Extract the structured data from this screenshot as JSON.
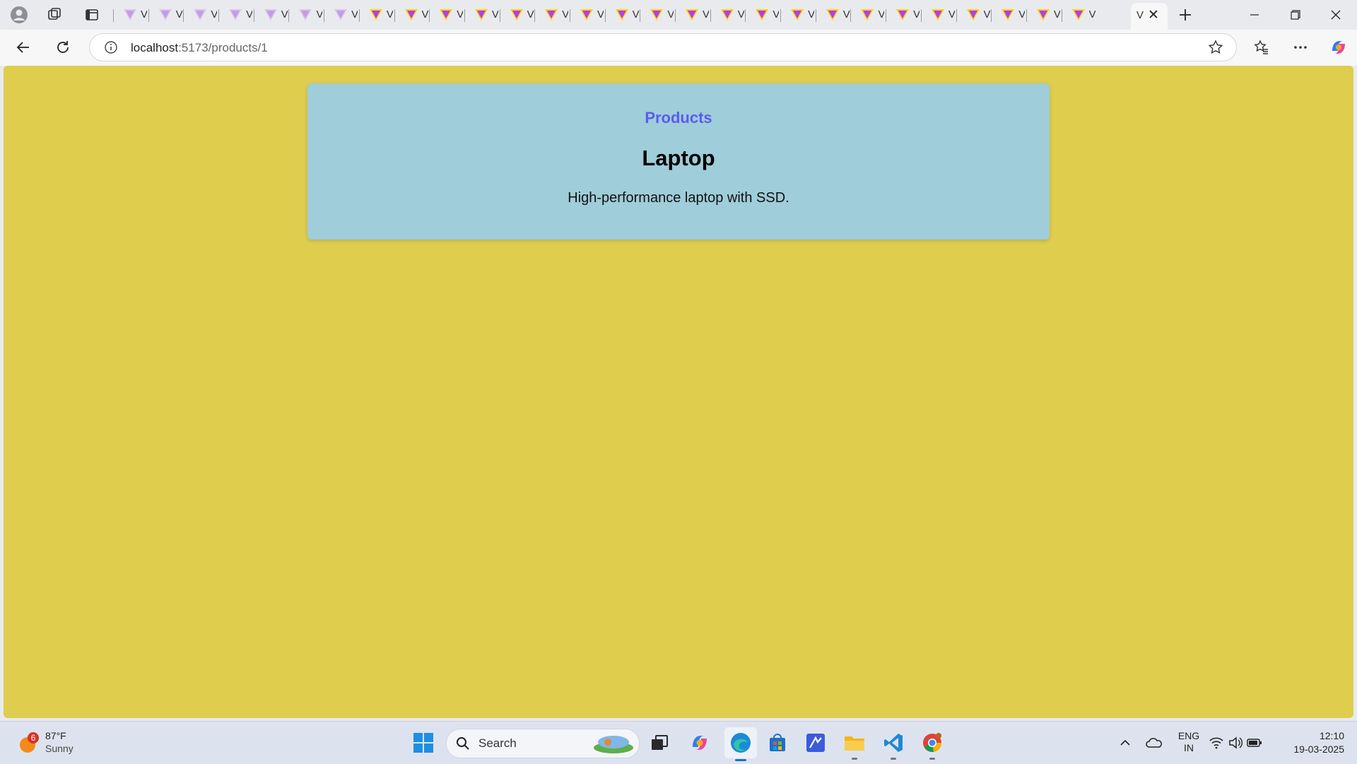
{
  "browser": {
    "tab_count_titles": 28,
    "tab_truncated_text": "V",
    "active_tab_truncated_title": "V",
    "address": {
      "host": "localhost",
      "path": ":5173/products/1"
    }
  },
  "page": {
    "nav_link": "Products",
    "product_name": "Laptop",
    "product_description": "High-performance laptop with SSD.",
    "colors": {
      "background": "#dfcd4e",
      "card": "#9fcdd9",
      "link": "#5a5cf0"
    }
  },
  "taskbar": {
    "weather": {
      "badge": "6",
      "temperature": "87°F",
      "condition": "Sunny"
    },
    "search_label": "Search",
    "language": {
      "lang": "ENG",
      "region": "IN"
    },
    "clock": {
      "time": "12:10",
      "date": "19-03-2025"
    },
    "apps": [
      "windows-start-icon",
      "file-explorer-icon",
      "copilot-icon",
      "edge-icon",
      "store-icon",
      "editor-icon",
      "folder-icon",
      "vscode-icon",
      "chrome-icon"
    ]
  }
}
